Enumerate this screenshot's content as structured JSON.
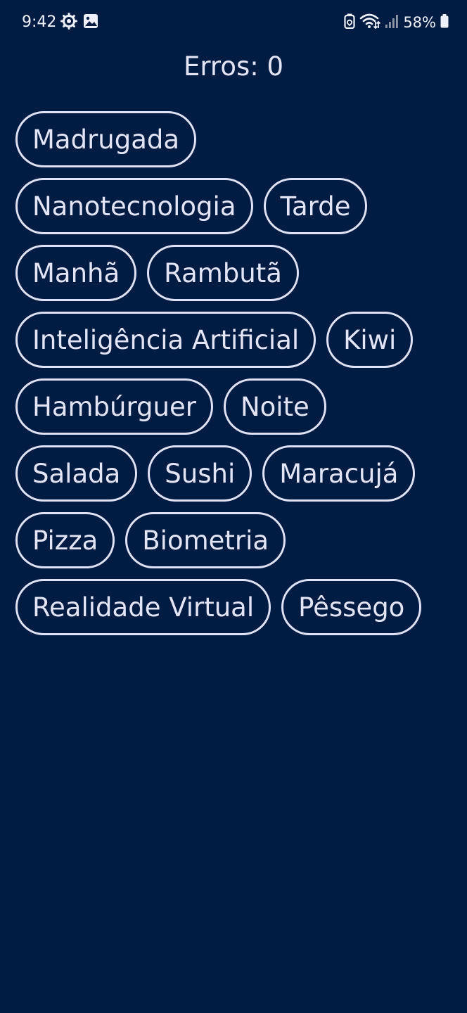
{
  "status_bar": {
    "time": "9:42",
    "left_icons": [
      "gear-icon",
      "image-icon"
    ],
    "right_icons": [
      "battery-saver-icon",
      "wifi-icon",
      "signal-icon"
    ],
    "battery_percent": "58%"
  },
  "score": {
    "label": "Erros: 0"
  },
  "chip_rows": [
    [
      "Madrugada"
    ],
    [
      "Nanotecnologia",
      "Tarde"
    ],
    [
      "Manhã",
      "Rambutã"
    ],
    [
      "Inteligência Artificial",
      "Kiwi"
    ],
    [
      "Hambúrguer",
      "Noite"
    ],
    [
      "Salada",
      "Sushi",
      "Maracujá"
    ],
    [
      "Pizza",
      "Biometria"
    ],
    [
      "Realidade Virtual",
      "Pêssego"
    ]
  ],
  "colors": {
    "background": "#011c42",
    "chip_border": "#dfe2f5",
    "text": "#e3e5f7"
  }
}
